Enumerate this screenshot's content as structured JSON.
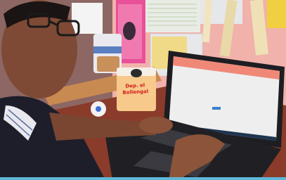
{
  "photo": {
    "jar_label_line1": "Dep. el",
    "jar_label_line2": "Bollengal"
  },
  "colors": {
    "wall": "#f3b7b0",
    "desk": "#8a3b2a",
    "laptop_screen": "#eeeeee",
    "site_header": "#f08878",
    "jar_body": "#f7c98a"
  }
}
